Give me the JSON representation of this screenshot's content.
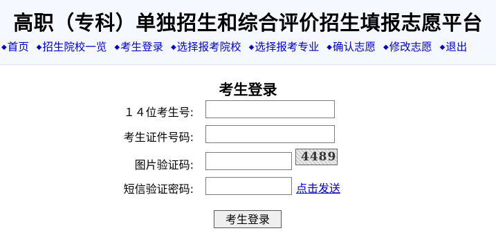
{
  "header": {
    "title": "高职（专科）单独招生和综合评价招生填报志愿平台",
    "nav": [
      "首页",
      "招生院校一览",
      "考生登录",
      "选择报考院校",
      "选择报考专业",
      "确认志愿",
      "修改志愿",
      "退出"
    ]
  },
  "login_form": {
    "title": "考生登录",
    "exam_number_label": "１４位考生号:",
    "id_number_label": "考生证件号码:",
    "captcha_label": "图片验证码:",
    "captcha_text": "4489",
    "sms_code_label": "短信验证密码:",
    "send_link": "点击发送",
    "submit_label": "考生登录"
  }
}
